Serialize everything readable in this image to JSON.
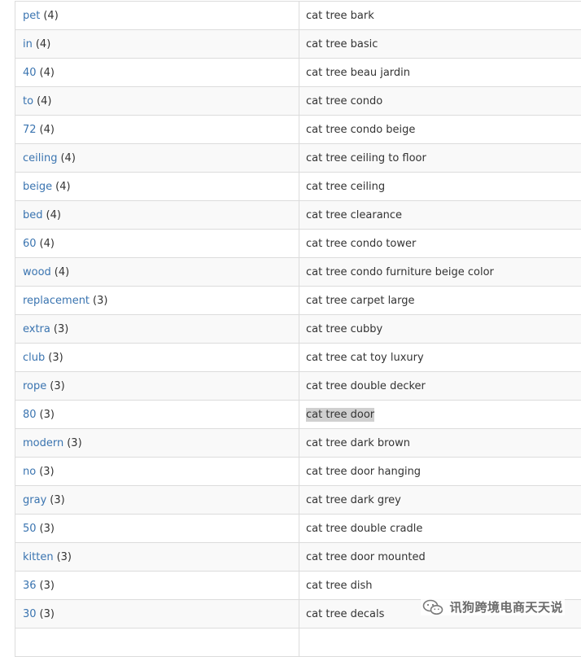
{
  "rows": [
    {
      "word": "pet",
      "count": "(4)",
      "phrase": "cat tree bark"
    },
    {
      "word": "in",
      "count": "(4)",
      "phrase": "cat tree basic"
    },
    {
      "word": "40",
      "count": "(4)",
      "phrase": "cat tree beau jardin"
    },
    {
      "word": "to",
      "count": "(4)",
      "phrase": "cat tree condo"
    },
    {
      "word": "72",
      "count": "(4)",
      "phrase": "cat tree condo beige"
    },
    {
      "word": "ceiling",
      "count": "(4)",
      "phrase": "cat tree ceiling to floor"
    },
    {
      "word": "beige",
      "count": "(4)",
      "phrase": "cat tree ceiling"
    },
    {
      "word": "bed",
      "count": "(4)",
      "phrase": "cat tree clearance"
    },
    {
      "word": "60",
      "count": "(4)",
      "phrase": "cat tree condo tower"
    },
    {
      "word": "wood",
      "count": "(4)",
      "phrase": "cat tree condo furniture beige color"
    },
    {
      "word": "replacement",
      "count": "(3)",
      "phrase": "cat tree carpet large"
    },
    {
      "word": "extra",
      "count": "(3)",
      "phrase": "cat tree cubby"
    },
    {
      "word": "club",
      "count": "(3)",
      "phrase": "cat tree cat toy luxury"
    },
    {
      "word": "rope",
      "count": "(3)",
      "phrase": "cat tree double decker"
    },
    {
      "word": "80",
      "count": "(3)",
      "phrase": "cat tree door",
      "highlighted": true
    },
    {
      "word": "modern",
      "count": "(3)",
      "phrase": "cat tree dark brown"
    },
    {
      "word": "no",
      "count": "(3)",
      "phrase": "cat tree door hanging"
    },
    {
      "word": "gray",
      "count": "(3)",
      "phrase": "cat tree dark grey"
    },
    {
      "word": "50",
      "count": "(3)",
      "phrase": "cat tree double cradle"
    },
    {
      "word": "kitten",
      "count": "(3)",
      "phrase": "cat tree door mounted"
    },
    {
      "word": "36",
      "count": "(3)",
      "phrase": "cat tree dish"
    },
    {
      "word": "30",
      "count": "(3)",
      "phrase": "cat tree decals"
    },
    {
      "word": "",
      "count": "",
      "phrase": ""
    }
  ],
  "watermark": {
    "icon": "wechat-icon",
    "text": "讯狗跨境电商天天说"
  },
  "colors": {
    "link": "#3a74b0",
    "border": "#dcdcdc",
    "highlight": "#d0d0d0"
  }
}
